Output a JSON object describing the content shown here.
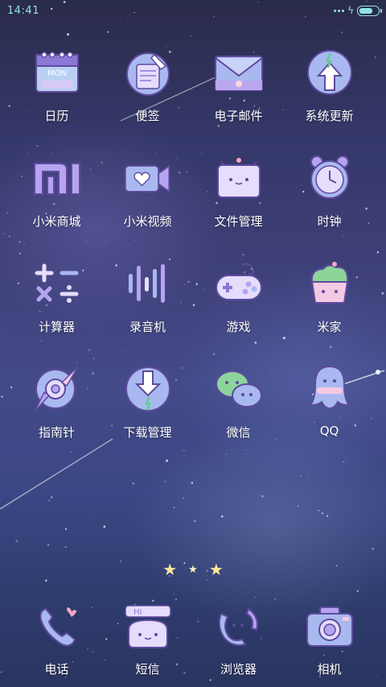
{
  "status_bar": {
    "time": "14:41",
    "battery_level": 0.8,
    "accent_color": "#8fe3e8"
  },
  "apps": [
    {
      "label": "日历",
      "icon": "calendar-icon",
      "icon_text": "MON"
    },
    {
      "label": "便签",
      "icon": "notes-icon"
    },
    {
      "label": "电子邮件",
      "icon": "email-icon"
    },
    {
      "label": "系统更新",
      "icon": "system-update-icon"
    },
    {
      "label": "小米商城",
      "icon": "mi-store-icon"
    },
    {
      "label": "小米视频",
      "icon": "mi-video-icon"
    },
    {
      "label": "文件管理",
      "icon": "file-manager-icon"
    },
    {
      "label": "时钟",
      "icon": "clock-icon"
    },
    {
      "label": "计算器",
      "icon": "calculator-icon"
    },
    {
      "label": "录音机",
      "icon": "recorder-icon"
    },
    {
      "label": "游戏",
      "icon": "game-controller-icon"
    },
    {
      "label": "米家",
      "icon": "mijia-icon"
    },
    {
      "label": "指南针",
      "icon": "compass-icon"
    },
    {
      "label": "下载管理",
      "icon": "download-manager-icon"
    },
    {
      "label": "微信",
      "icon": "wechat-icon"
    },
    {
      "label": "QQ",
      "icon": "qq-icon"
    }
  ],
  "dock": [
    {
      "label": "电话",
      "icon": "phone-icon"
    },
    {
      "label": "短信",
      "icon": "messages-icon",
      "icon_text": "HI"
    },
    {
      "label": "浏览器",
      "icon": "browser-icon"
    },
    {
      "label": "相机",
      "icon": "camera-icon"
    }
  ],
  "page_indicator": {
    "pages": 3,
    "current": 2
  }
}
